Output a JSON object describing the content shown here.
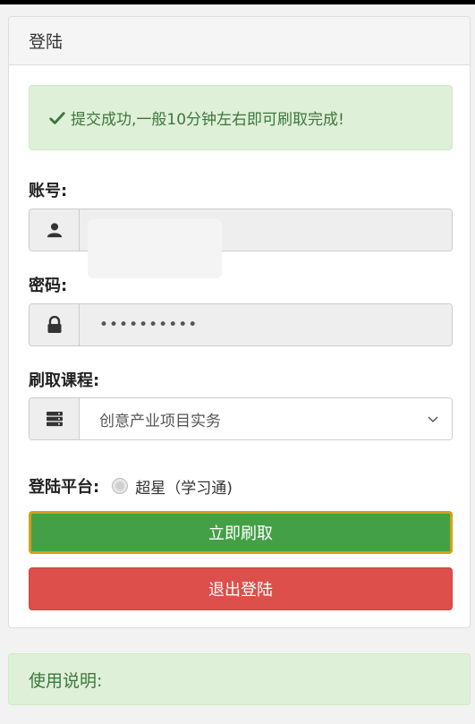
{
  "panel": {
    "title": "登陆"
  },
  "alert": {
    "message": "提交成功,一般10分钟左右即可刷取完成!",
    "icon": "check-icon"
  },
  "account": {
    "label": "账号:",
    "value": "",
    "icon": "user-icon"
  },
  "password": {
    "label": "密码:",
    "value": "••••••••••",
    "icon": "lock-icon"
  },
  "course": {
    "label": "刷取课程:",
    "selected": "创意产业项目实务",
    "icon": "server-icon"
  },
  "platform": {
    "label": "登陆平台:",
    "option": "超星（学习通)"
  },
  "buttons": {
    "submit": "立即刷取",
    "logout": "退出登陆"
  },
  "notes": {
    "title": "使用说明:"
  },
  "colors": {
    "success_bg": "#dff0d8",
    "success_text": "#3c763d",
    "green": "#43a047",
    "red": "#dc4f4a"
  }
}
